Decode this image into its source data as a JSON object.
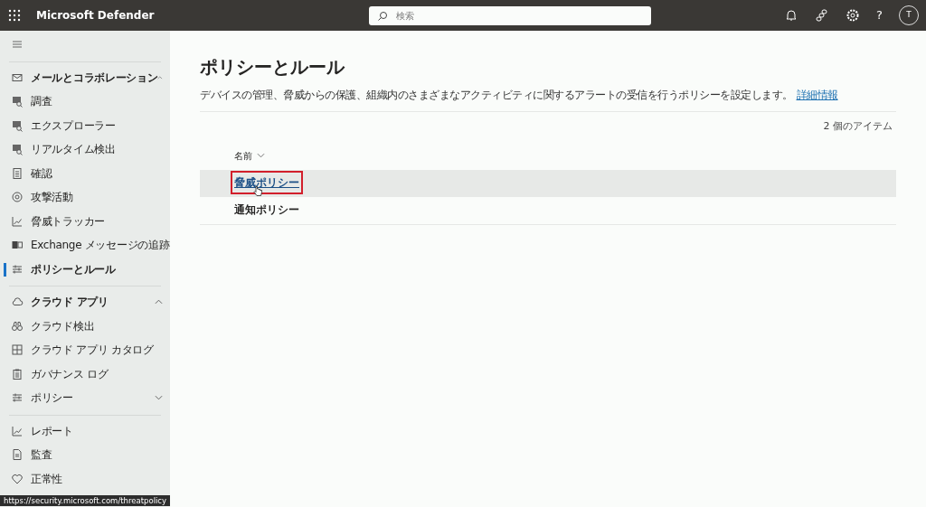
{
  "header": {
    "title": "Microsoft Defender",
    "search": {
      "placeholder": "検索"
    },
    "help": "?",
    "avatar": "T"
  },
  "sidebar": {
    "sections": [
      {
        "label": "メールとコラボレーション",
        "kind": "mail",
        "expanded": true,
        "items": [
          {
            "label": "調査",
            "kind": "investigate",
            "selected": false
          },
          {
            "label": "エクスプローラー",
            "kind": "investigate",
            "selected": false
          },
          {
            "label": "リアルタイム検出",
            "kind": "investigate",
            "selected": false
          },
          {
            "label": "確認",
            "kind": "doc",
            "selected": false
          },
          {
            "label": "攻撃活動",
            "kind": "target",
            "selected": false
          },
          {
            "label": "脅威トラッカー",
            "kind": "chart",
            "selected": false
          },
          {
            "label": "Exchange メッセージの追跡",
            "kind": "exchange",
            "selected": false
          },
          {
            "label": "ポリシーとルール",
            "kind": "sliders",
            "selected": true
          }
        ]
      },
      {
        "label": "クラウド アプリ",
        "kind": "cloud",
        "expanded": true,
        "items": [
          {
            "label": "クラウド検出",
            "kind": "binoculars",
            "selected": false
          },
          {
            "label": "クラウド アプリ カタログ",
            "kind": "grid",
            "selected": false
          },
          {
            "label": "ガバナンス ログ",
            "kind": "clipboard",
            "selected": false
          },
          {
            "label": "ポリシー",
            "kind": "sliders",
            "selected": false,
            "expanded": false
          }
        ]
      },
      {
        "items": [
          {
            "label": "レポート",
            "kind": "chart",
            "selected": false
          },
          {
            "label": "監査",
            "kind": "report",
            "selected": false
          },
          {
            "label": "正常性",
            "kind": "heart",
            "selected": false
          }
        ]
      }
    ]
  },
  "main": {
    "title": "ポリシーとルール",
    "description": "デバイスの管理、脅威からの保護、組織内のさまざまなアクティビティに関するアラートの受信を行うポリシーを設定します。",
    "link": "詳細情報",
    "item_count": "2 個のアイテム",
    "table": {
      "columns": [
        "名前"
      ],
      "rows": [
        {
          "name": "脅威ポリシー",
          "selected": true,
          "highlighted": true
        },
        {
          "name": "通知ポリシー",
          "selected": false,
          "highlighted": false
        }
      ]
    }
  },
  "status_url": "https://security.microsoft.com/threatpolicy"
}
